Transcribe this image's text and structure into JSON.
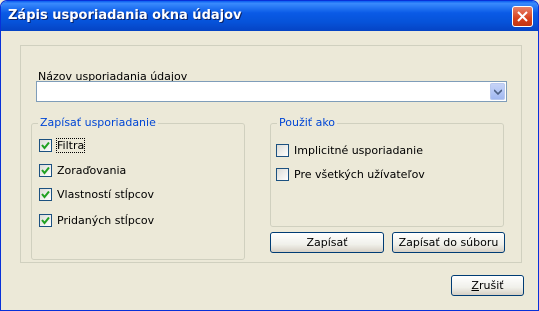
{
  "window": {
    "title": "Zápis usporiadania okna údajov"
  },
  "name_field": {
    "label": "Názov usporiadania údajov",
    "value": ""
  },
  "write_group": {
    "title": "Zapísať usporiadanie",
    "items": [
      {
        "label": "Filtra",
        "checked": true
      },
      {
        "label": "Zoraďovania",
        "checked": true
      },
      {
        "label": "Vlastností stĺpcov",
        "checked": true
      },
      {
        "label": "Pridaných stĺpcov",
        "checked": true
      }
    ]
  },
  "use_group": {
    "title": "Použiť ako",
    "items": [
      {
        "label": "Implicitné usporiadanie",
        "checked": false
      },
      {
        "label": "Pre všetkých užívateľov",
        "checked": false
      }
    ]
  },
  "buttons": {
    "write": "Zapísať",
    "write_to_file": "Zapísať do súboru",
    "cancel": "Zrušiť"
  },
  "colors": {
    "titlebar": "#0a5ae6",
    "group_title": "#0046d5",
    "checkmark": "#21a121"
  }
}
